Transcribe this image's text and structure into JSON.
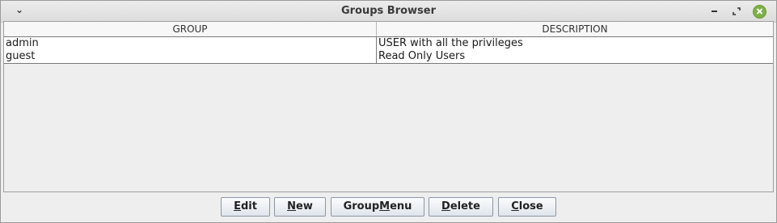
{
  "window": {
    "title": "Groups Browser",
    "icons": {
      "menu": "chevron-down-icon",
      "minimize": "minimize-icon",
      "maximize": "maximize-icon",
      "close": "close-icon"
    },
    "close_color": "#7fb046"
  },
  "table": {
    "columns": [
      "GROUP",
      "DESCRIPTION"
    ],
    "rows": [
      {
        "group": "admin",
        "description": "USER with all the privileges"
      },
      {
        "group": "guest",
        "description": "Read Only Users"
      }
    ]
  },
  "buttons": {
    "edit": {
      "mnemonic": "E",
      "rest": "dit"
    },
    "new": {
      "mnemonic": "N",
      "rest": "ew"
    },
    "groupmenu": {
      "pre": "Group",
      "mnemonic": "M",
      "rest": "enu"
    },
    "delete": {
      "mnemonic": "D",
      "rest": "elete"
    },
    "close": {
      "mnemonic": "C",
      "rest": "lose"
    }
  }
}
